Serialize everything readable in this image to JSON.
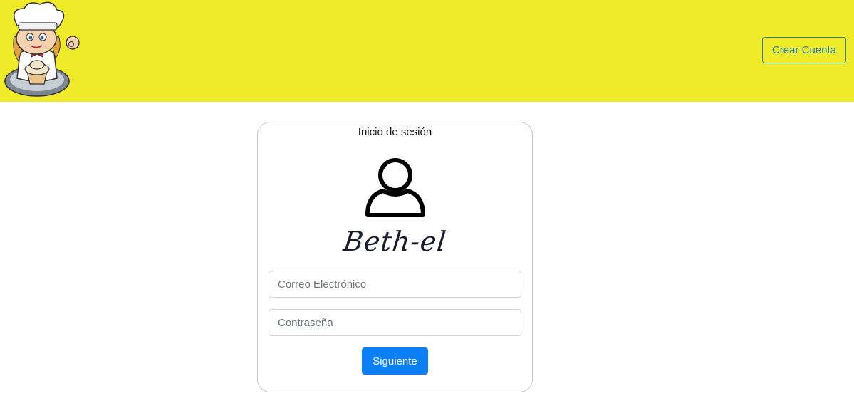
{
  "header": {
    "create_account_label": "Crear Cuenta"
  },
  "login": {
    "title": "Inicio de sesión",
    "brand": "Beth-el",
    "email_placeholder": "Correo Electrónico",
    "password_placeholder": "Contraseña",
    "next_label": "Siguiente"
  },
  "colors": {
    "header_bg": "#efeb29",
    "primary": "#0d7ff5",
    "outline_link": "#1f86c8"
  },
  "icons": {
    "logo": "chef-mascot-logo",
    "user": "user-icon"
  }
}
